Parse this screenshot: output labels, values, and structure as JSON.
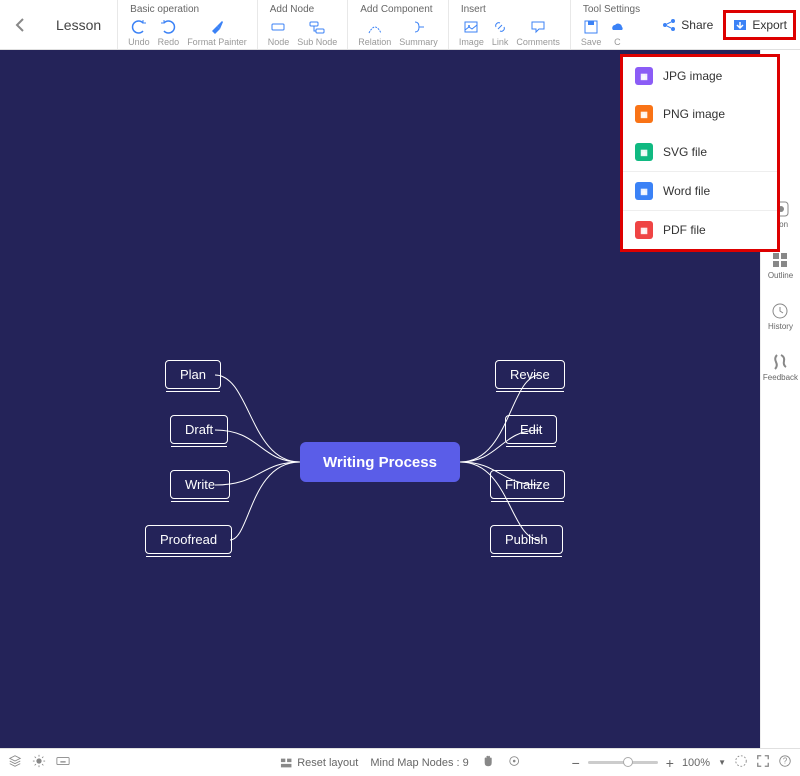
{
  "header": {
    "title": "Lesson"
  },
  "toolbar": {
    "sections": [
      {
        "title": "Basic operation",
        "buttons": [
          "Undo",
          "Redo",
          "Format Painter"
        ]
      },
      {
        "title": "Add Node",
        "buttons": [
          "Node",
          "Sub Node"
        ]
      },
      {
        "title": "Add Component",
        "buttons": [
          "Relation",
          "Summary"
        ]
      },
      {
        "title": "Insert",
        "buttons": [
          "Image",
          "Link",
          "Comments"
        ]
      },
      {
        "title": "Tool Settings",
        "buttons": [
          "Save",
          "C"
        ]
      }
    ],
    "share": "Share",
    "export": "Export"
  },
  "export_menu": [
    {
      "label": "JPG image",
      "color": "#8b5cf6"
    },
    {
      "label": "PNG image",
      "color": "#f97316"
    },
    {
      "label": "SVG file",
      "color": "#10b981"
    },
    {
      "label": "Word file",
      "color": "#3b82f6",
      "sep": true
    },
    {
      "label": "PDF file",
      "color": "#ef4444",
      "sep": true
    }
  ],
  "sidebar": [
    {
      "label": "Icon"
    },
    {
      "label": "Outline"
    },
    {
      "label": "History"
    },
    {
      "label": "Feedback"
    }
  ],
  "mindmap": {
    "central": "Writing Process",
    "left": [
      "Plan",
      "Draft",
      "Write",
      "Proofread"
    ],
    "right": [
      "Revise",
      "Edit",
      "Finalize",
      "Publish"
    ]
  },
  "statusbar": {
    "reset": "Reset layout",
    "nodes_label": "Mind Map Nodes :",
    "nodes_count": "9",
    "zoom": "100%"
  }
}
